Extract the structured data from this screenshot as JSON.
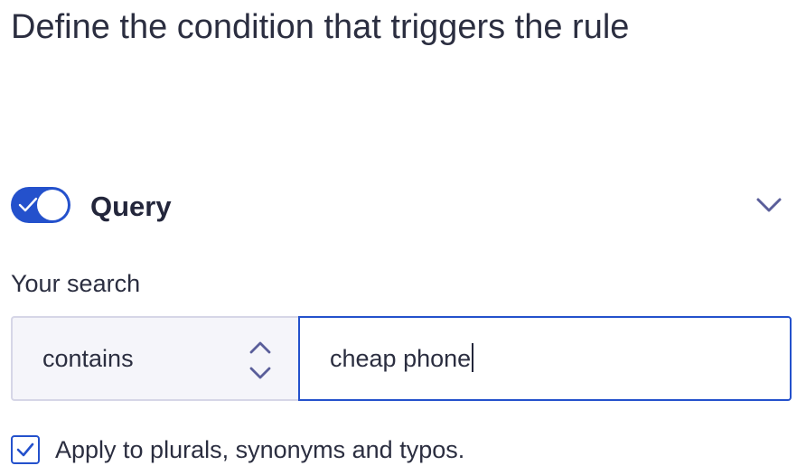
{
  "header": {
    "title": "Define the condition that triggers the rule"
  },
  "query_section": {
    "toggle_state": "on",
    "title": "Query",
    "collapse_icon": "chevron-down-icon",
    "search_label": "Your search",
    "operator": {
      "selected": "contains",
      "icon": "select-arrows-icon"
    },
    "query_input": {
      "value": "cheap phone"
    },
    "apply_variants": {
      "checked": true,
      "label": "Apply to plurals, synonyms and typos."
    }
  },
  "colors": {
    "accent": "#2451cc",
    "text": "#23263b",
    "border": "#d6d6e7",
    "select_background": "#f5f5fa",
    "icon": "#5a5e9a"
  }
}
